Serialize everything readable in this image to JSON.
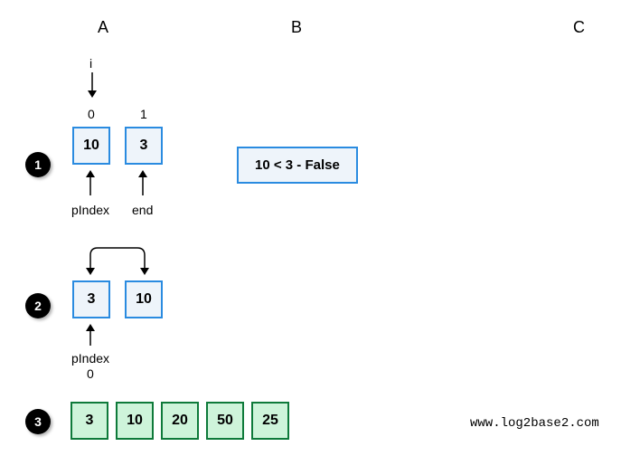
{
  "columns": {
    "a": "A",
    "b": "B",
    "c": "C"
  },
  "step1": {
    "num": "1",
    "i_label": "i",
    "indices": [
      "0",
      "1"
    ],
    "cells": [
      "10",
      "3"
    ],
    "pindex_label": "pIndex",
    "end_label": "end",
    "condition": "10 < 3 - False"
  },
  "step2": {
    "num": "2",
    "cells": [
      "3",
      "10"
    ],
    "pindex_label": "pIndex",
    "pindex_value": "0"
  },
  "step3": {
    "num": "3",
    "cells": [
      "3",
      "10",
      "20",
      "50",
      "25"
    ]
  },
  "watermark": "www.log2base2.com"
}
